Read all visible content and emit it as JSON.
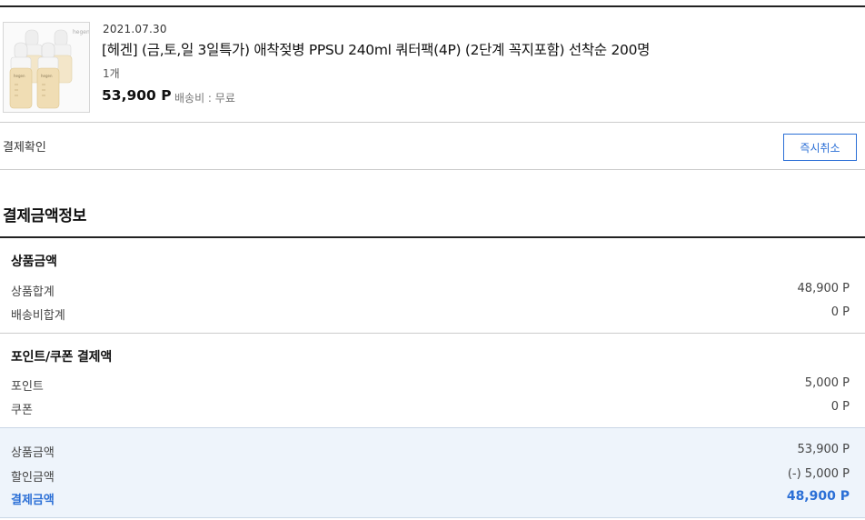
{
  "order_item": {
    "date": "2021.07.30",
    "title": "[헤겐] (금,토,일 3일특가) 애착젖병 PPSU 240ml 쿼터팩(4P) (2단계 꼭지포함) 선착순 200명",
    "quantity": "1개",
    "price": "53,900 P",
    "shipping": "배송비 : 무료",
    "thumbnail_brand": "hegen"
  },
  "status": {
    "label": "결제확인",
    "cancel_button": "즉시취소"
  },
  "payment_info": {
    "section_title": "결제금액정보",
    "product_group": {
      "title": "상품금액",
      "rows": [
        {
          "label": "상품합계",
          "value": "48,900 P"
        },
        {
          "label": "배송비합계",
          "value": "0 P"
        }
      ]
    },
    "discount_group": {
      "title": "포인트/쿠폰 결제액",
      "rows": [
        {
          "label": "포인트",
          "value": "5,000 P"
        },
        {
          "label": "쿠폰",
          "value": "0 P"
        }
      ]
    },
    "summary": {
      "rows": [
        {
          "label": "상품금액",
          "value": "53,900 P"
        },
        {
          "label": "할인금액",
          "value": "(-) 5,000 P"
        }
      ],
      "total_label": "결제금액",
      "total_value": "48,900 P"
    }
  },
  "colors": {
    "accent": "#2b6fd6",
    "summary_bg": "#eef4fb",
    "rule_dark": "#222222",
    "rule_light": "#cccccc"
  }
}
